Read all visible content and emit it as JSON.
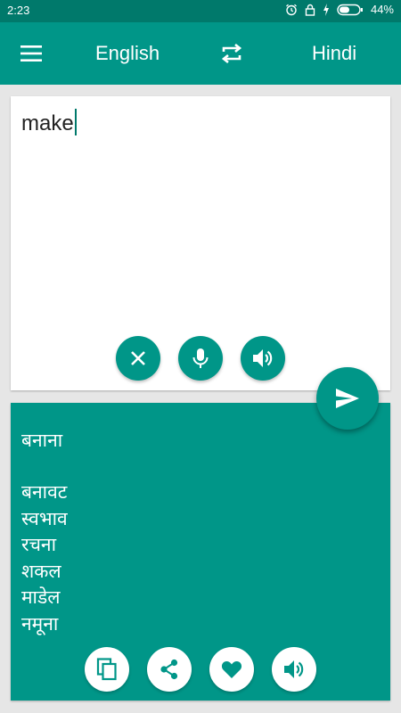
{
  "status_bar": {
    "time": "2:23",
    "battery_percent": "44%"
  },
  "app_bar": {
    "source_language": "English",
    "target_language": "Hindi"
  },
  "input": {
    "text": "make"
  },
  "output": {
    "primary_translation": "बनाना",
    "alternatives": [
      "बनावट",
      "स्वभाव",
      "रचना",
      "शकल",
      "माडेल",
      "नमूना"
    ]
  },
  "colors": {
    "primary": "#009688",
    "primary_dark": "#00796b",
    "background": "#e6e6e6"
  },
  "icons": {
    "menu": "hamburger-icon",
    "swap": "swap-icon",
    "clear": "close-icon",
    "mic": "microphone-icon",
    "speak": "speaker-icon",
    "translate": "send-icon",
    "copy": "copy-icon",
    "share": "share-icon",
    "favorite": "heart-icon"
  }
}
